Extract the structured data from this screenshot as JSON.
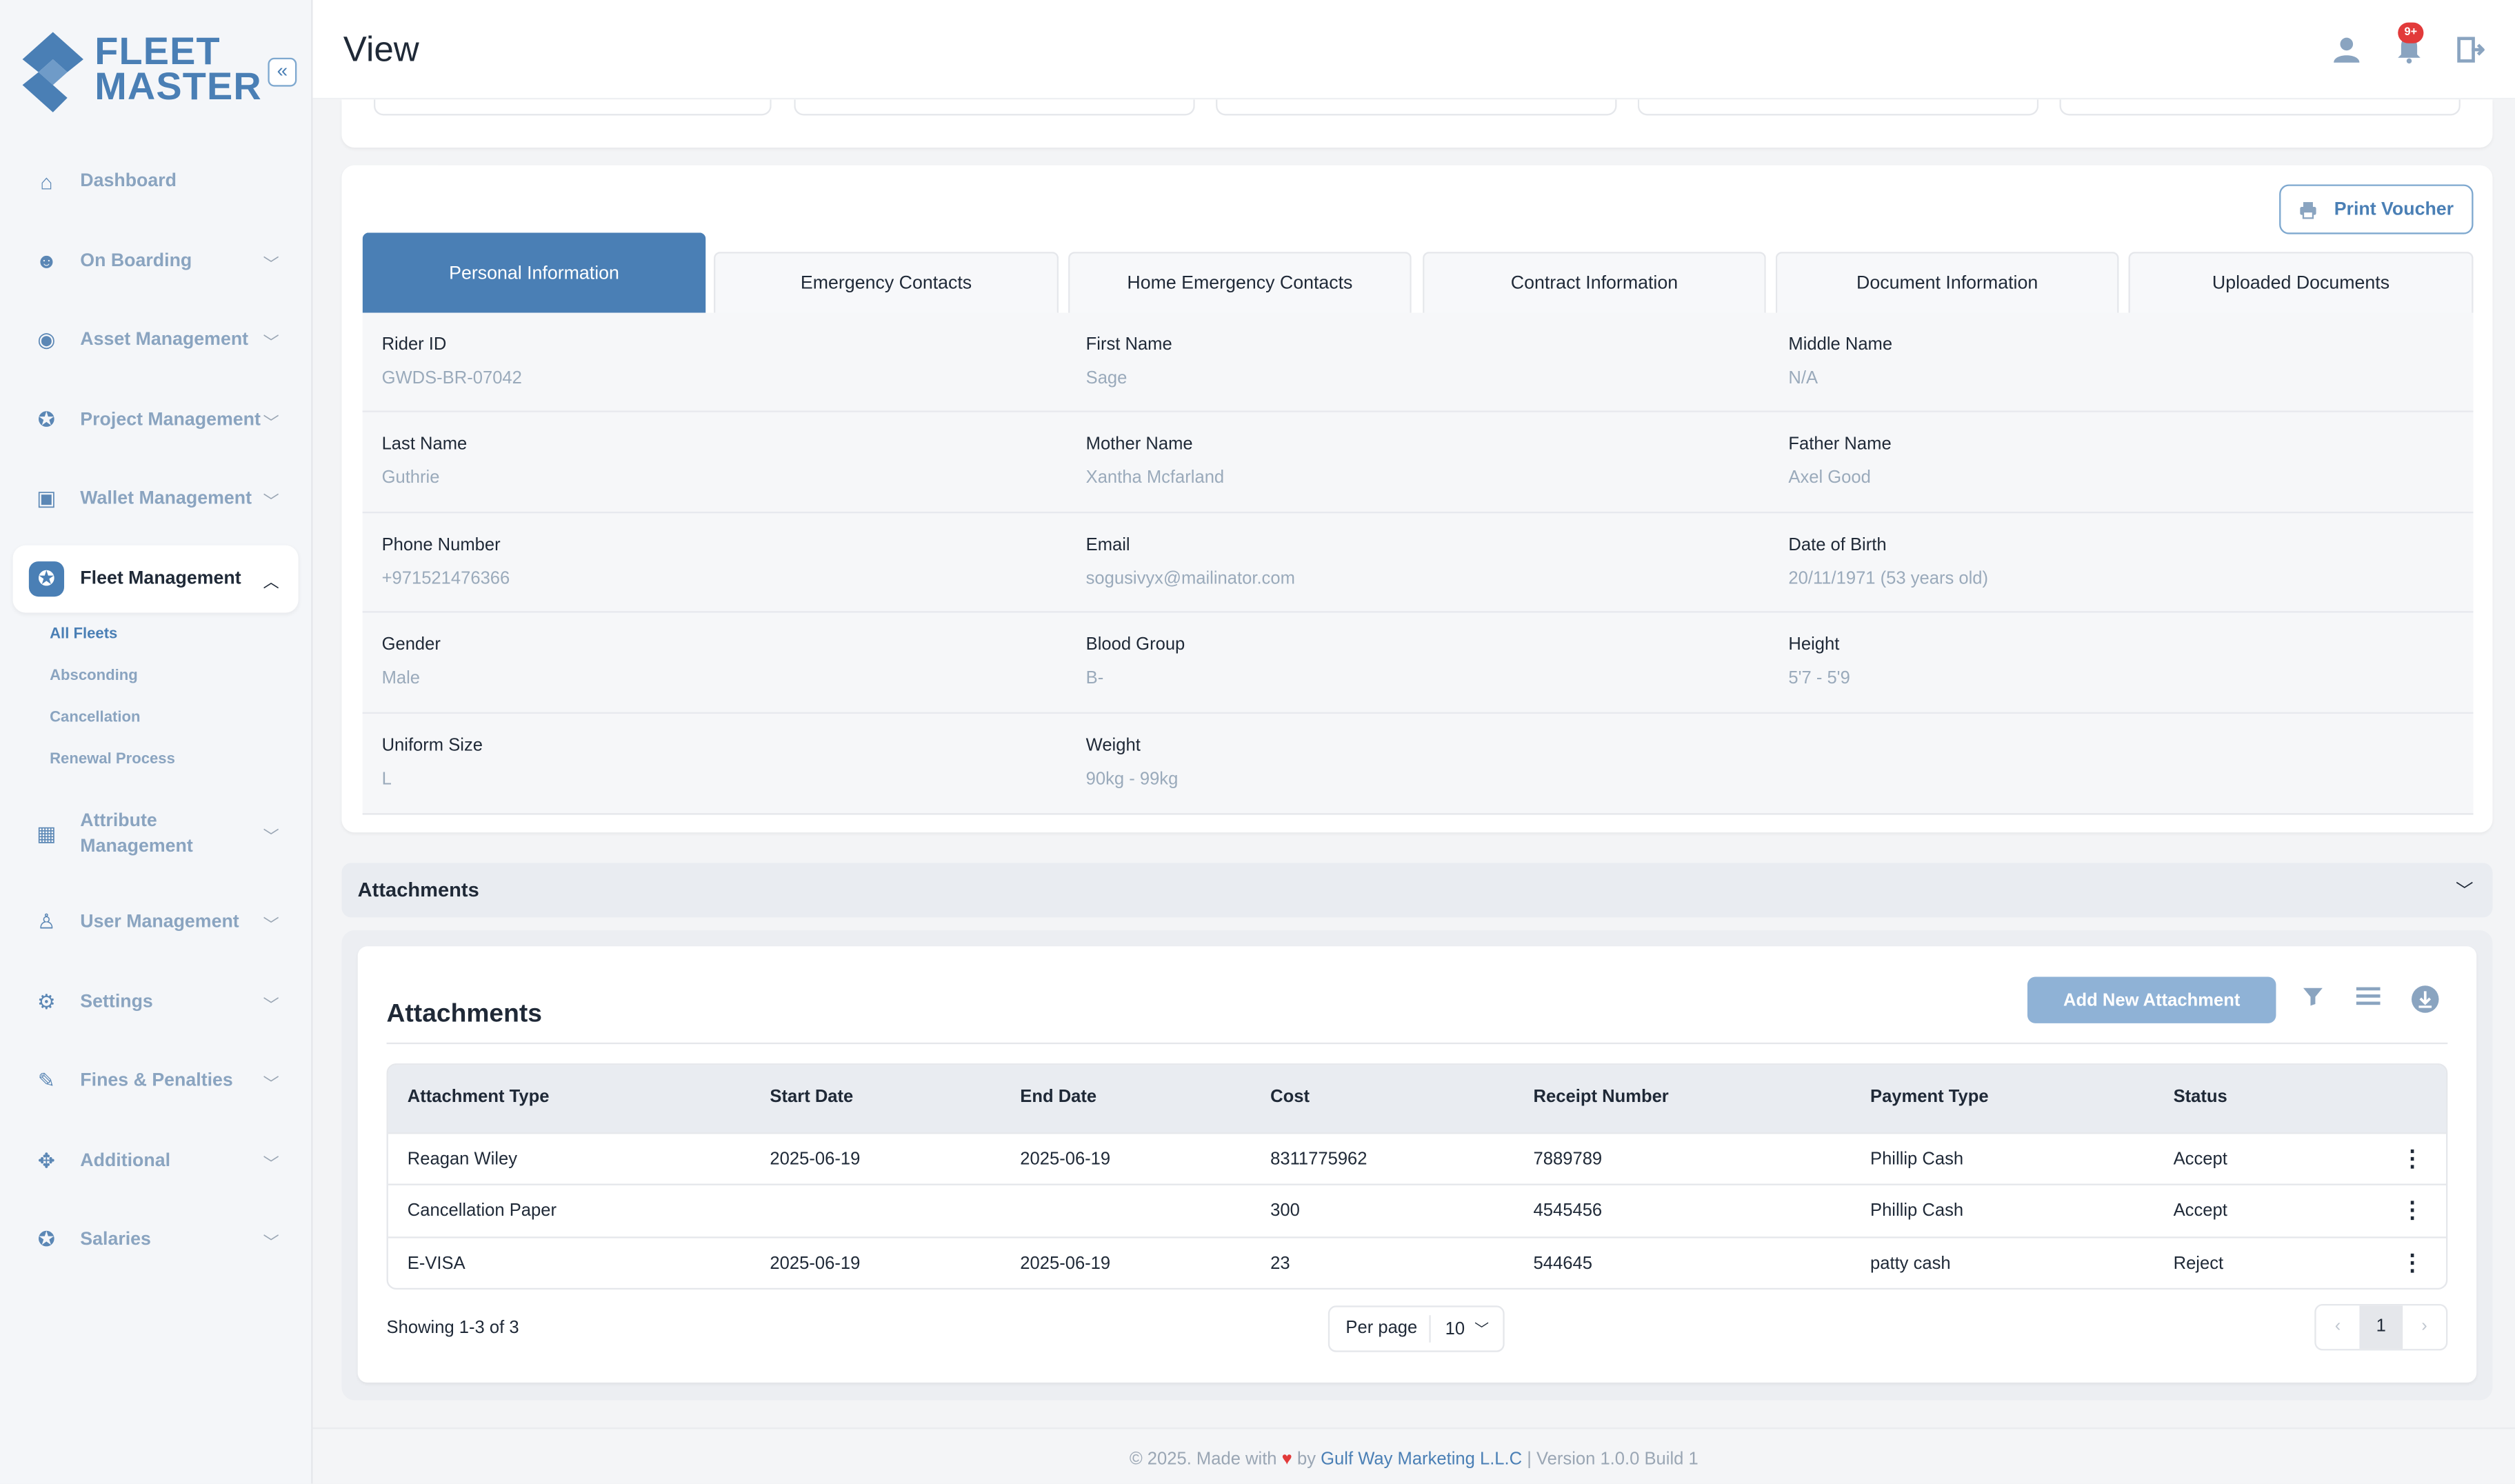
{
  "app": {
    "logo_line1": "FLEET",
    "logo_line2": "MASTER",
    "brand_color": "#4a7fb5"
  },
  "header": {
    "title": "View",
    "notification_badge": "9+"
  },
  "sidebar": {
    "items": [
      {
        "label": "Dashboard",
        "icon": "home-icon"
      },
      {
        "label": "On Boarding",
        "icon": "onboarding-icon"
      },
      {
        "label": "Asset Management",
        "icon": "asset-icon"
      },
      {
        "label": "Project Management",
        "icon": "project-icon"
      },
      {
        "label": "Wallet Management",
        "icon": "wallet-icon"
      },
      {
        "label": "Fleet Management",
        "icon": "fleet-icon"
      },
      {
        "label": "Attribute Management",
        "icon": "attribute-icon"
      },
      {
        "label": "User Management",
        "icon": "users-icon"
      },
      {
        "label": "Settings",
        "icon": "gear-icon"
      },
      {
        "label": "Fines & Penalties",
        "icon": "fines-icon"
      },
      {
        "label": "Additional",
        "icon": "additional-icon"
      },
      {
        "label": "Salaries",
        "icon": "salary-icon"
      }
    ],
    "fleet_sub": [
      "All Fleets",
      "Absconding",
      "Cancellation",
      "Renewal Process"
    ]
  },
  "actions": {
    "print_voucher": "Print Voucher"
  },
  "tabs": [
    "Personal Information",
    "Emergency Contacts",
    "Home Emergency Contacts",
    "Contract Information",
    "Document Information",
    "Uploaded Documents"
  ],
  "personal": [
    [
      {
        "k": "Rider ID",
        "v": "GWDS-BR-07042"
      },
      {
        "k": "First Name",
        "v": "Sage"
      },
      {
        "k": "Middle Name",
        "v": "N/A"
      }
    ],
    [
      {
        "k": "Last Name",
        "v": "Guthrie"
      },
      {
        "k": "Mother Name",
        "v": "Xantha Mcfarland"
      },
      {
        "k": "Father Name",
        "v": "Axel Good"
      }
    ],
    [
      {
        "k": "Phone Number",
        "v": "+971521476366"
      },
      {
        "k": "Email",
        "v": "sogusivyx@mailinator.com"
      },
      {
        "k": "Date of Birth",
        "v": "20/11/1971 (53 years old)"
      }
    ],
    [
      {
        "k": "Gender",
        "v": "Male"
      },
      {
        "k": "Blood Group",
        "v": "B-"
      },
      {
        "k": "Height",
        "v": "5'7 - 5'9"
      }
    ],
    [
      {
        "k": "Uniform Size",
        "v": "L"
      },
      {
        "k": "Weight",
        "v": "90kg - 99kg"
      }
    ]
  ],
  "attachments": {
    "section_title": "Attachments",
    "card_title": "Attachments",
    "add_button": "Add New Attachment",
    "columns": [
      "Attachment Type",
      "Start Date",
      "End Date",
      "Cost",
      "Receipt Number",
      "Payment Type",
      "Status"
    ],
    "rows": [
      [
        "Reagan Wiley",
        "2025-06-19",
        "2025-06-19",
        "8311775962",
        "7889789",
        "Phillip Cash",
        "Accept"
      ],
      [
        "Cancellation Paper",
        "",
        "",
        "300",
        "4545456",
        "Phillip Cash",
        "Accept"
      ],
      [
        "E-VISA",
        "2025-06-19",
        "2025-06-19",
        "23",
        "544645",
        "patty cash",
        "Reject"
      ]
    ],
    "showing": "Showing 1-3 of 3",
    "per_page_label": "Per page",
    "per_page_value": "10",
    "current_page": "1"
  },
  "footer": {
    "prefix": "© 2025. Made with",
    "by": "by",
    "company": "Gulf Way Marketing L.L.C",
    "version": "| Version 1.0.0 Build 1"
  }
}
